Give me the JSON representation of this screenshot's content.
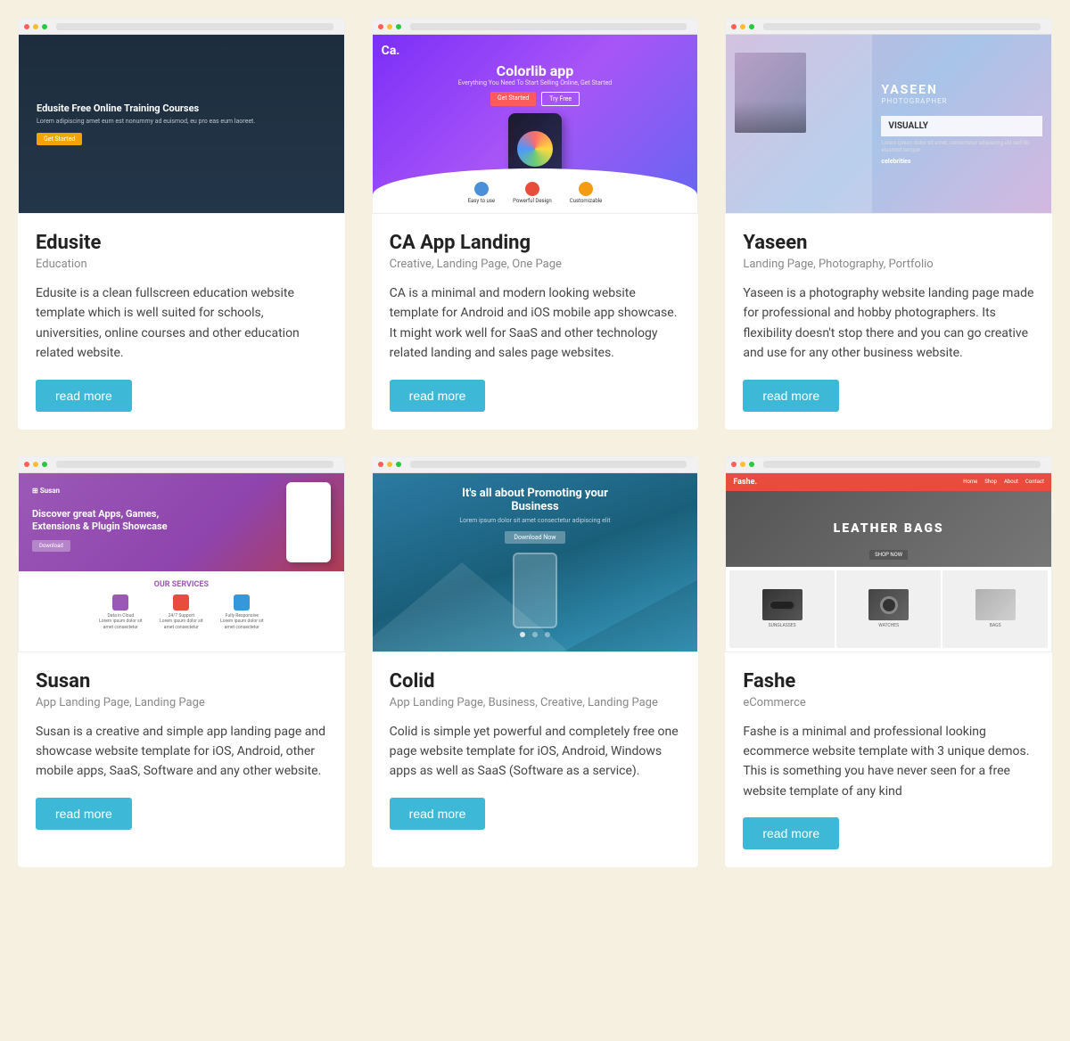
{
  "cards": [
    {
      "id": "edusite",
      "title": "Edusite",
      "tags": "Education",
      "description": "Edusite is a clean fullscreen education website template which is well suited for schools, universities, online courses and other education related website.",
      "read_more": "read more"
    },
    {
      "id": "ca-app-landing",
      "title": "CA App Landing",
      "tags": "Creative, Landing Page, One Page",
      "description": "CA is a minimal and modern looking website template for Android and iOS mobile app showcase. It might work well for SaaS and other technology related landing and sales page websites.",
      "read_more": "read more"
    },
    {
      "id": "yaseen",
      "title": "Yaseen",
      "tags": "Landing Page, Photography, Portfolio",
      "description": "Yaseen is a photography website landing page made for professional and hobby photographers. Its flexibility doesn't stop there and you can go creative and use for any other business website.",
      "read_more": "read more"
    },
    {
      "id": "susan",
      "title": "Susan",
      "tags": "App Landing Page, Landing Page",
      "description": "Susan is a creative and simple app landing page and showcase website template for iOS, Android, other mobile apps, SaaS, Software and any other website.",
      "read_more": "read more"
    },
    {
      "id": "colid",
      "title": "Colid",
      "tags": "App Landing Page, Business, Creative, Landing Page",
      "description": "Colid is simple yet powerful and completely free one page website template for iOS, Android, Windows apps as well as SaaS (Software as a service).",
      "read_more": "read more"
    },
    {
      "id": "fashe",
      "title": "Fashe",
      "tags": "eCommerce",
      "description": "Fashe is a minimal and professional looking ecommerce website template with 3 unique demos. This is something you have never seen for a free website template of any kind",
      "read_more": "read more"
    }
  ]
}
